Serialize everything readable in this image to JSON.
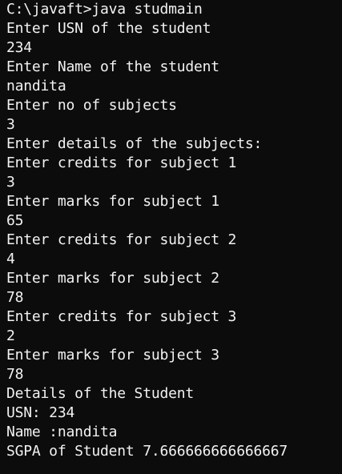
{
  "console": {
    "lines": [
      "C:\\javaft>java studmain",
      "Enter USN of the student",
      "234",
      "Enter Name of the student",
      "nandita",
      "Enter no of subjects",
      "3",
      "Enter details of the subjects:",
      "Enter credits for subject 1",
      "3",
      "Enter marks for subject 1",
      "65",
      "Enter credits for subject 2",
      "4",
      "Enter marks for subject 2",
      "78",
      "Enter credits for subject 3",
      "2",
      "Enter marks for subject 3",
      "78",
      "Details of the Student",
      "USN: 234",
      "Name :nandita",
      "SGPA of Student 7.666666666666667"
    ]
  },
  "colors": {
    "background": "#0c0c0c",
    "text": "#f2f2f2"
  }
}
